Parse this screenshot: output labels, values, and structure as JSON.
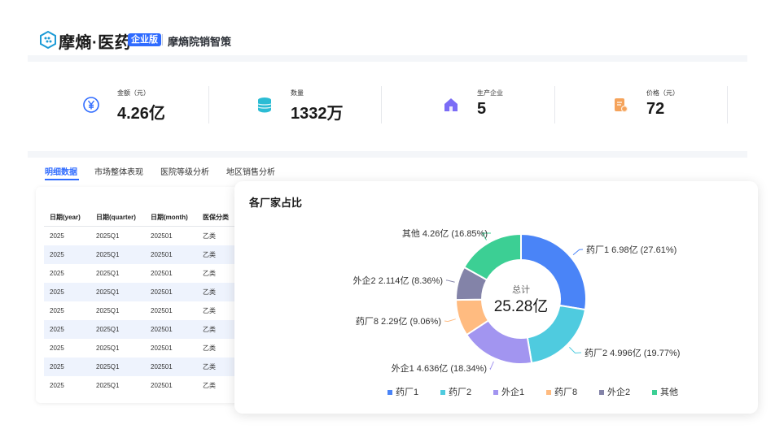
{
  "header": {
    "brand": "摩熵·医药",
    "badge": "企业版",
    "product": "摩熵院销智策"
  },
  "kpis": [
    {
      "label": "金额（元）",
      "value": "4.26亿",
      "icon": "yen-icon",
      "color": "#2f6bff",
      "bg": "#e6edff"
    },
    {
      "label": "数量",
      "value": "1332万",
      "icon": "database-icon",
      "color": "#2bbcd4",
      "bg": "#e0f6f9"
    },
    {
      "label": "生产企业",
      "value": "5",
      "icon": "factory-icon",
      "color": "#7b6cf6",
      "bg": "#ede9fe"
    },
    {
      "label": "价格（元）",
      "value": "72",
      "icon": "price-tag-icon",
      "color": "#f5a35b",
      "bg": "#fdeede"
    }
  ],
  "tabs": [
    "明细数据",
    "市场整体表现",
    "医院等级分析",
    "地区销售分析"
  ],
  "table": {
    "headers": [
      "日期(year)",
      "日期(quarter)",
      "日期(month)",
      "医保分类"
    ],
    "rows": [
      [
        "2025",
        "2025Q1",
        "202501",
        "乙类"
      ],
      [
        "2025",
        "2025Q1",
        "202501",
        "乙类"
      ],
      [
        "2025",
        "2025Q1",
        "202501",
        "乙类"
      ],
      [
        "2025",
        "2025Q1",
        "202501",
        "乙类"
      ],
      [
        "2025",
        "2025Q1",
        "202501",
        "乙类"
      ],
      [
        "2025",
        "2025Q1",
        "202501",
        "乙类"
      ],
      [
        "2025",
        "2025Q1",
        "202501",
        "乙类"
      ],
      [
        "2025",
        "2025Q1",
        "202501",
        "乙类"
      ],
      [
        "2025",
        "2025Q1",
        "202501",
        "乙类"
      ]
    ]
  },
  "chart": {
    "title": "各厂家占比",
    "center_label": "总计",
    "center_value": "25.28亿"
  },
  "chart_data": {
    "type": "pie",
    "donut": true,
    "title": "各厂家占比",
    "total": "25.28亿",
    "slices": [
      {
        "name": "药厂1",
        "value": 6.98,
        "display": "6.98亿",
        "percent": 27.61,
        "color": "#4a84f7"
      },
      {
        "name": "药厂2",
        "value": 4.996,
        "display": "4.996亿",
        "percent": 19.77,
        "color": "#4fcbdf"
      },
      {
        "name": "外企1",
        "value": 4.636,
        "display": "4.636亿",
        "percent": 18.34,
        "color": "#a295f0"
      },
      {
        "name": "药厂8",
        "value": 2.29,
        "display": "2.29亿",
        "percent": 9.06,
        "color": "#ffbb80"
      },
      {
        "name": "外企2",
        "value": 2.114,
        "display": "2.114亿",
        "percent": 8.36,
        "color": "#8383a8"
      },
      {
        "name": "其他",
        "value": 4.26,
        "display": "4.26亿",
        "percent": 16.85,
        "color": "#3ccf94"
      }
    ],
    "legend_position": "bottom"
  }
}
